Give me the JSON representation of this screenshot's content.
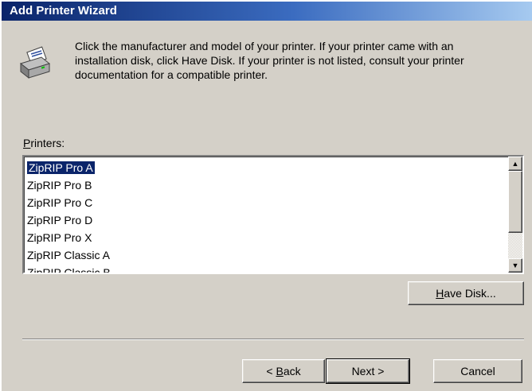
{
  "window": {
    "title": "Add Printer Wizard"
  },
  "intro": {
    "icon": "printer-icon",
    "text": "Click the manufacturer and model of your printer. If your printer came with an\ninstallation disk, click Have Disk. If your printer is not listed, consult your printer\ndocumentation for a compatible printer."
  },
  "printers": {
    "label": {
      "before": "",
      "accel": "P",
      "after": "rinters:"
    },
    "items": [
      "ZipRIP Pro A",
      "ZipRIP Pro B",
      "ZipRIP Pro C",
      "ZipRIP Pro D",
      "ZipRIP Pro X",
      "ZipRIP Classic A",
      "ZipRIP Classic B"
    ],
    "selected_index": 0
  },
  "buttons": {
    "have_disk": {
      "before": "",
      "accel": "H",
      "after": "ave Disk..."
    },
    "back": {
      "before": "< ",
      "accel": "B",
      "after": "ack"
    },
    "next": {
      "label": "Next >"
    },
    "cancel": {
      "label": "Cancel"
    }
  },
  "colors": {
    "title_gradient_start": "#0a246a",
    "title_gradient_end": "#a6caf0",
    "selection": "#0a246a",
    "face": "#d4d0c8"
  }
}
